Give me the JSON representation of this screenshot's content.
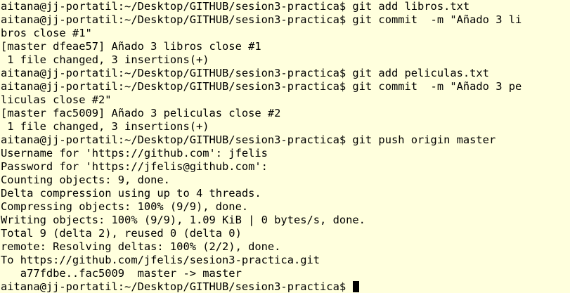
{
  "terminal": {
    "background": "#ffffdd",
    "foreground": "#000000",
    "lines": [
      "aitana@jj-portatil:~/Desktop/GITHUB/sesion3-practica$ git add libros.txt",
      "aitana@jj-portatil:~/Desktop/GITHUB/sesion3-practica$ git commit  -m \"Añado 3 li",
      "bros close #1\"",
      "[master dfeae57] Añado 3 libros close #1",
      " 1 file changed, 3 insertions(+)",
      "aitana@jj-portatil:~/Desktop/GITHUB/sesion3-practica$ git add peliculas.txt",
      "aitana@jj-portatil:~/Desktop/GITHUB/sesion3-practica$ git commit  -m \"Añado 3 pe",
      "liculas close #2\"",
      "[master fac5009] Añado 3 peliculas close #2",
      " 1 file changed, 3 insertions(+)",
      "aitana@jj-portatil:~/Desktop/GITHUB/sesion3-practica$ git push origin master",
      "Username for 'https://github.com': jfelis",
      "Password for 'https://jfelis@github.com':",
      "Counting objects: 9, done.",
      "Delta compression using up to 4 threads.",
      "Compressing objects: 100% (9/9), done.",
      "Writing objects: 100% (9/9), 1.09 KiB | 0 bytes/s, done.",
      "Total 9 (delta 2), reused 0 (delta 0)",
      "remote: Resolving deltas: 100% (2/2), done.",
      "To https://github.com/jfelis/sesion3-practica.git",
      "   a77fdbe..fac5009  master -> master"
    ],
    "prompt": "aitana@jj-portatil:~/Desktop/GITHUB/sesion3-practica$ "
  }
}
